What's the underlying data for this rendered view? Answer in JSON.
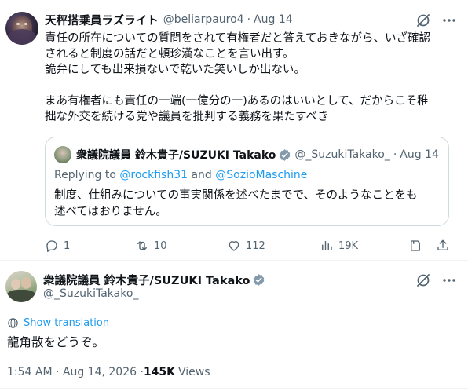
{
  "tweet": {
    "author_name": "天秤搭乗員ラズライト",
    "author_handle": "@beliarpauro4",
    "separator": "·",
    "date": "Aug 14",
    "body_lines": [
      "責任の所在についての質問をされて有権者だと答えておきながら、いざ確認",
      "されると制度の話だと頓珍漢なことを言い出す。",
      "詭弁にしても出来損ないで乾いた笑いしか出ない。",
      "まあ有権者にも責任の一端(一億分の一)あるのはいいとして、だからこそ稚",
      "拙な外交を続ける党や議員を批判する義務を果たすべき"
    ],
    "quote": {
      "author_name": "衆議院議員 鈴木貴子/SUZUKI Takako",
      "author_handle": "@_SuzukiTakako_",
      "separator": "·",
      "date": "Aug 14",
      "replying_prefix": "Replying to ",
      "replying_user1": "@rockfish31",
      "replying_and": " and ",
      "replying_user2": "@SozioMaschine",
      "body_lines": [
        "制度、仕組みについての事実関係を述べたまでで、そのようなことをも",
        "述べてはおりません。"
      ]
    },
    "actions": {
      "replies": "1",
      "retweets": "10",
      "likes": "112",
      "views": "19K"
    }
  },
  "main_tweet": {
    "author_name": "衆議院議員 鈴木貴子/SUZUKI Takako",
    "author_handle": "@_SuzukiTakako_",
    "show_translation": "Show translation",
    "body": "龍角散をどうぞ。",
    "timestamp": "1:54 AM · Aug 14, 2026 · ",
    "views_count": "145K",
    "views_label": "Views"
  },
  "colors": {
    "text_primary": "#0f1419",
    "text_secondary": "#536471",
    "accent_blue": "#1d9bf0",
    "border": "#cfd9de",
    "verified_gray": "#829aab"
  },
  "icons": [
    "grok-icon",
    "more-icon",
    "verified-badge-icon",
    "reply-icon",
    "retweet-icon",
    "like-icon",
    "views-icon",
    "bookmark-share-icon",
    "translate-icon"
  ]
}
